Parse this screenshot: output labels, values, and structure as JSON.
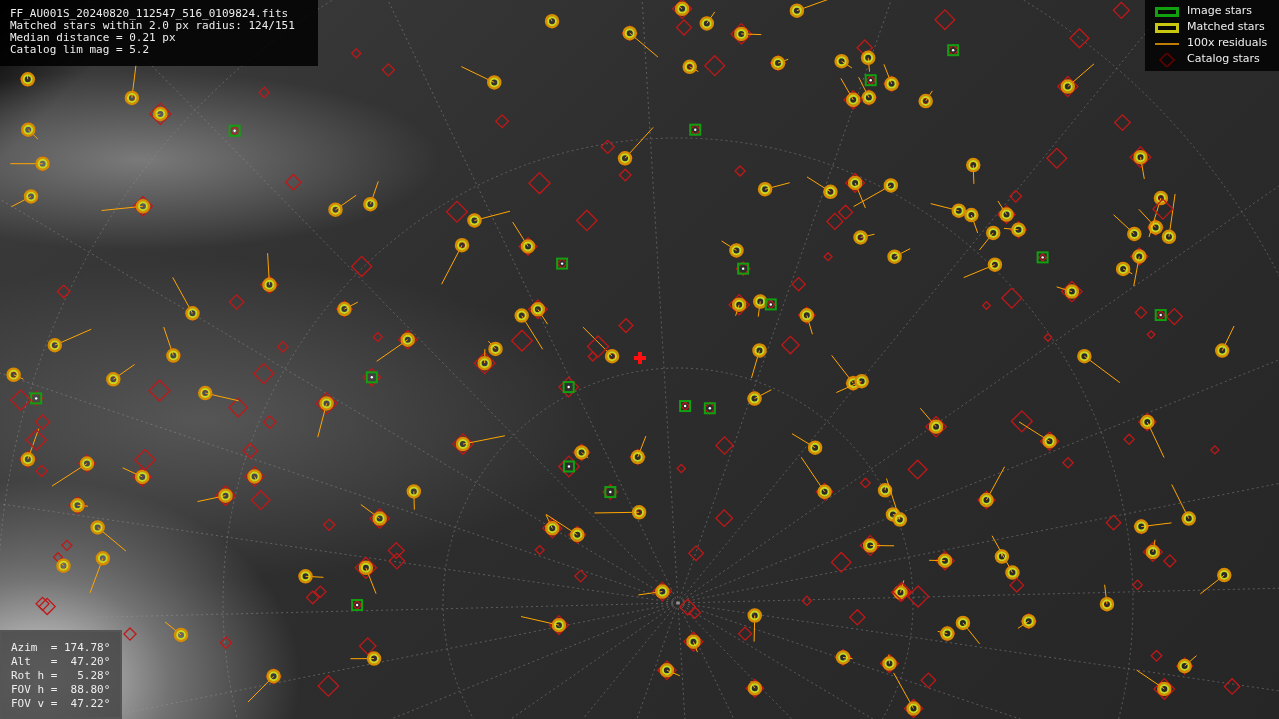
{
  "header": {
    "lines": [
      "FF_AU001S_20240820_112547_516_0109824.fits",
      "Matched stars within 2.0 px radius: 124/151",
      "Median distance = 0.21 px",
      "Catalog lim mag = 5.2"
    ]
  },
  "legend": [
    {
      "kind": "image",
      "label": "Image stars"
    },
    {
      "kind": "matched",
      "label": "Matched stars"
    },
    {
      "kind": "residual",
      "label": "100x residuals"
    },
    {
      "kind": "catalog",
      "label": "Catalog stars"
    }
  ],
  "readout": {
    "lines": [
      "Azim  = 174.78°",
      "Alt   =  47.20°",
      "Rot h =   5.28°",
      "FOV h =  88.80°",
      "FOV v =  47.22°"
    ]
  }
}
